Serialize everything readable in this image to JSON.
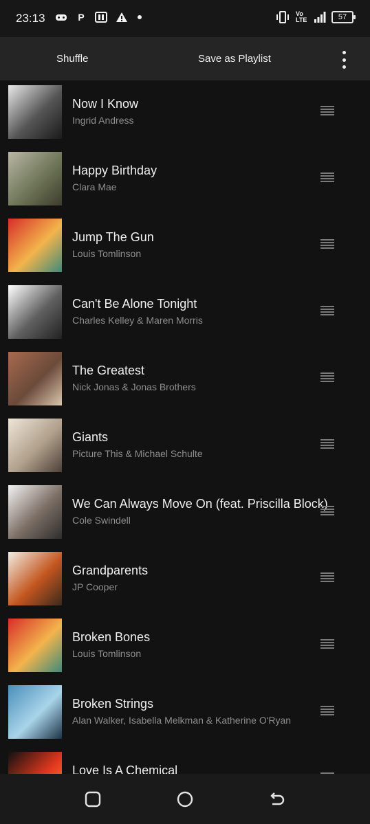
{
  "status": {
    "time": "23:13",
    "network": "Vo LTE",
    "battery": "57",
    "icons": [
      "game-icon",
      "parking-icon",
      "paytm-icon",
      "warning-icon",
      "dot-icon",
      "vibrate-icon",
      "signal-icon",
      "battery-icon"
    ]
  },
  "toolbar": {
    "shuffle_label": "Shuffle",
    "save_label": "Save as Playlist",
    "more_icon": "more-vert-icon"
  },
  "tracks": [
    {
      "title": "Now I Know",
      "artist": "Ingrid Andress",
      "art_colors": [
        "#e8e8e8",
        "#555555",
        "#1b1b1b"
      ]
    },
    {
      "title": "Happy Birthday",
      "artist": "Clara Mae",
      "art_colors": [
        "#b8b6a4",
        "#6f7658",
        "#3c3c2c"
      ]
    },
    {
      "title": "Jump The Gun",
      "artist": "Louis Tomlinson",
      "art_colors": [
        "#d62e2a",
        "#f3b44c",
        "#3f8a7a"
      ]
    },
    {
      "title": "Can't Be Alone Tonight",
      "artist": "Charles Kelley & Maren Morris",
      "art_colors": [
        "#ffffff",
        "#606060",
        "#222222"
      ]
    },
    {
      "title": "The Greatest",
      "artist": "Nick Jonas & Jonas Brothers",
      "art_colors": [
        "#a86a4e",
        "#6b4a3a",
        "#d9c7ae"
      ]
    },
    {
      "title": "Giants",
      "artist": "Picture This & Michael Schulte",
      "art_colors": [
        "#efe6d8",
        "#b0a08c",
        "#4d4038"
      ]
    },
    {
      "title": "We Can Always Move On (feat. Priscilla Block)",
      "artist": "Cole Swindell",
      "art_colors": [
        "#f2f2f2",
        "#7b6e64",
        "#2e2e2e"
      ]
    },
    {
      "title": "Grandparents",
      "artist": "JP Cooper",
      "art_colors": [
        "#f1ede3",
        "#c4561f",
        "#3a2a1c"
      ]
    },
    {
      "title": "Broken Bones",
      "artist": "Louis Tomlinson",
      "art_colors": [
        "#d62e2a",
        "#f3b44c",
        "#3f8a7a"
      ]
    },
    {
      "title": "Broken Strings",
      "artist": "Alan Walker, Isabella Melkman & Katherine O'Ryan",
      "art_colors": [
        "#4a8fb9",
        "#a9d4ea",
        "#1d3446"
      ]
    },
    {
      "title": "Love Is A Chemical",
      "artist": "",
      "art_colors": [
        "#111111",
        "#e2381e",
        "#f59b2c"
      ]
    }
  ],
  "navbar": {
    "icons": [
      "recent-apps-icon",
      "home-icon",
      "back-icon"
    ]
  }
}
